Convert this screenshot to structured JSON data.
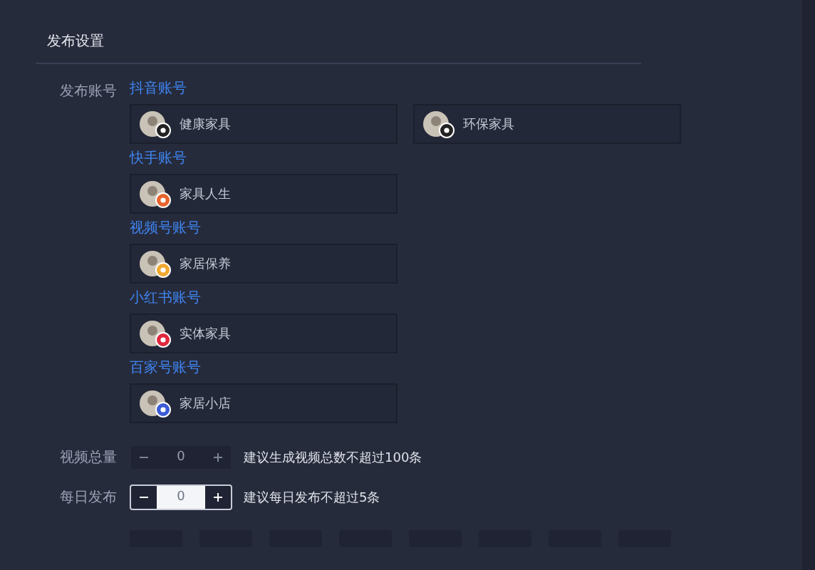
{
  "section_title": "发布设置",
  "account_label": "发布账号",
  "groups": [
    {
      "title": "抖音账号",
      "accounts": [
        {
          "name": "健康家具",
          "color": "#222222"
        },
        {
          "name": "环保家具",
          "color": "#222222"
        }
      ]
    },
    {
      "title": "快手账号",
      "accounts": [
        {
          "name": "家具人生",
          "color": "#e8632b"
        }
      ]
    },
    {
      "title": "视频号账号",
      "accounts": [
        {
          "name": "家居保养",
          "color": "#f0a830"
        }
      ]
    },
    {
      "title": "小红书账号",
      "accounts": [
        {
          "name": "实体家具",
          "color": "#e0283c"
        }
      ]
    },
    {
      "title": "百家号账号",
      "accounts": [
        {
          "name": "家居小店",
          "color": "#3b5bd6"
        }
      ]
    }
  ],
  "steppers": [
    {
      "label": "视频总量",
      "value": "0",
      "focused": false,
      "hint": "建议生成视频总数不超过100条"
    },
    {
      "label": "每日发布",
      "value": "0",
      "focused": true,
      "hint": "建议每日发布不超过5条"
    }
  ]
}
